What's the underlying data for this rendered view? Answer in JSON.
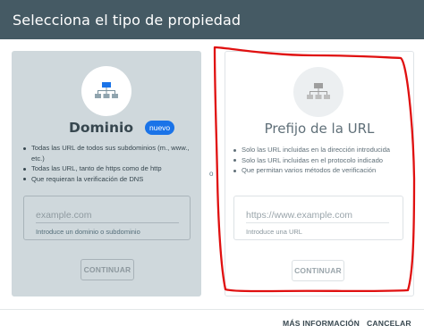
{
  "header": {
    "title": "Selecciona el tipo de propiedad"
  },
  "domain_card": {
    "title": "Dominio",
    "badge": "nuevo",
    "bullets": [
      "Todas las URL de todos sus subdominios (m., www., etc.)",
      "Todas las URL, tanto de https como de http",
      "Que requieran la verificación de DNS"
    ],
    "input_placeholder": "example.com",
    "input_hint": "Introduce un dominio o subdominio",
    "continue_label": "CONTINUAR"
  },
  "separator": {
    "label": "o"
  },
  "url_prefix_card": {
    "title": "Prefijo de la URL",
    "bullets": [
      "Solo las URL incluidas en la dirección introducida",
      "Solo las URL incluidas en el protocolo indicado",
      "Que permitan varios métodos de verificación"
    ],
    "input_placeholder": "https://www.example.com",
    "input_hint": "Introduce una URL",
    "continue_label": "CONTINUAR"
  },
  "footer": {
    "more_info_label": "MÁS INFORMACIÓN",
    "cancel_label": "CANCELAR"
  },
  "colors": {
    "header_bg": "#455a64",
    "domain_card_bg": "#cfd8dc",
    "badge_bg": "#1a73e8",
    "sitemap_icon_blue": "#1a73e8",
    "sitemap_icon_grey": "#9e9e9e",
    "annotation_red": "#e01010"
  },
  "icons": {
    "domain_card_icon": "sitemap-icon",
    "url_prefix_card_icon": "sitemap-icon"
  }
}
